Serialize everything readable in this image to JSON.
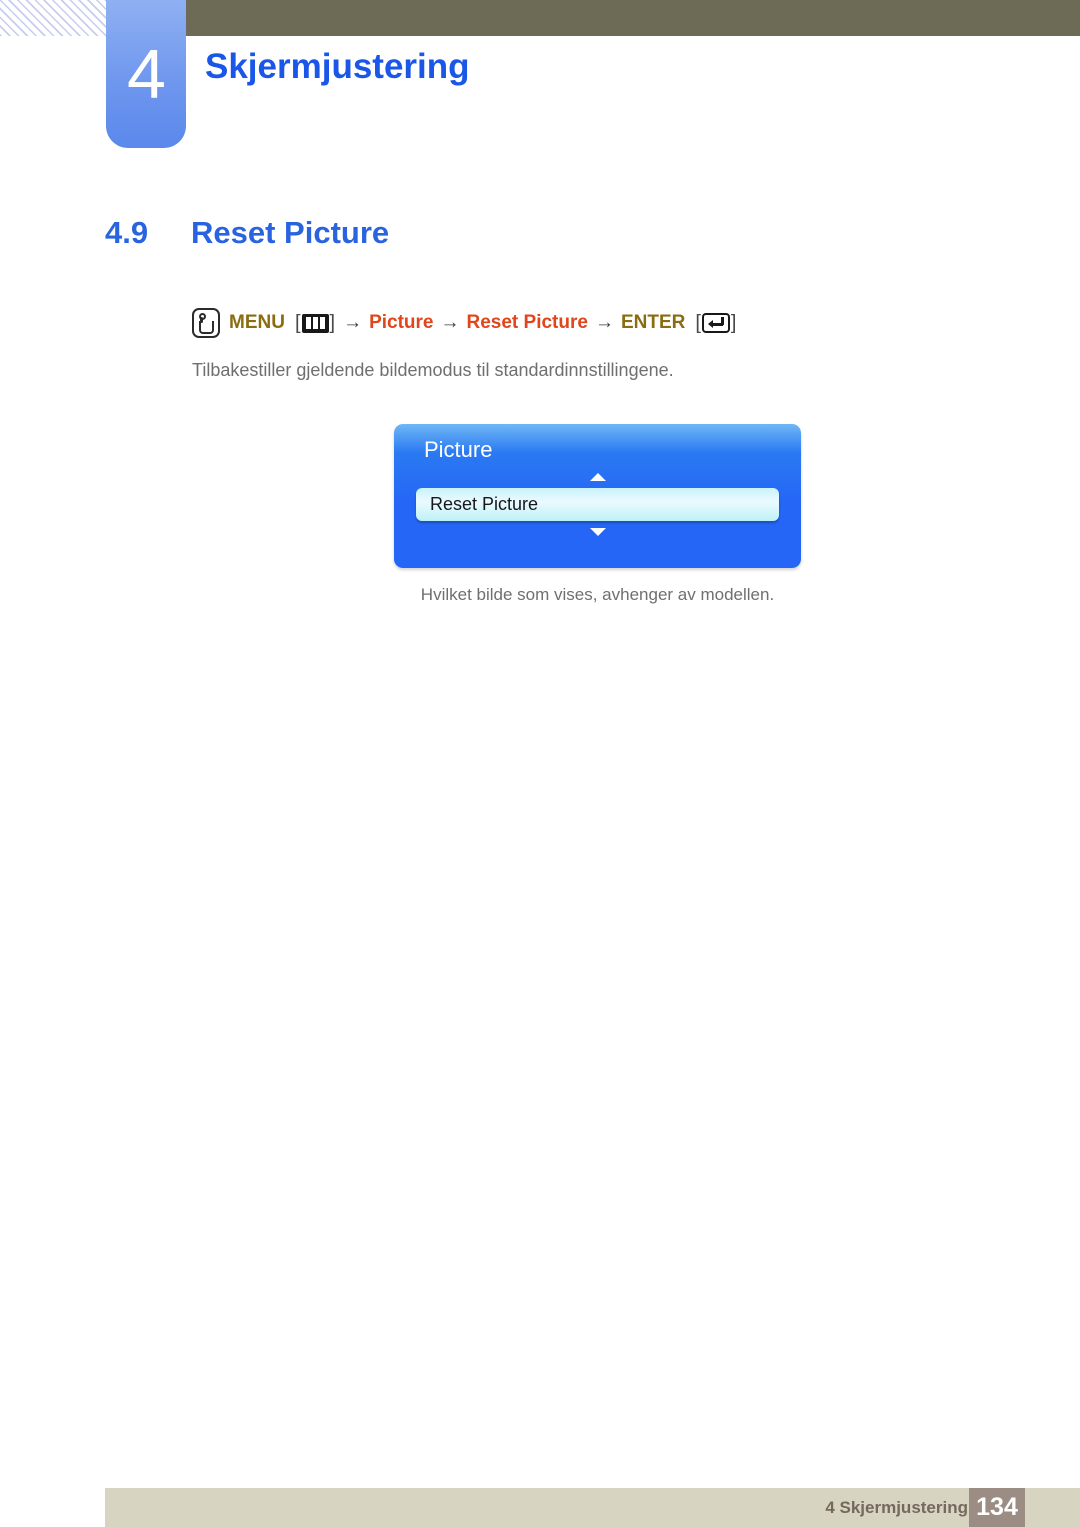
{
  "header": {
    "chapter_number": "4",
    "chapter_title": "Skjermjustering",
    "bar_color": "#6d6b55",
    "accent_color": "#1a57e8"
  },
  "section": {
    "number": "4.9",
    "title": "Reset Picture"
  },
  "menu_path": {
    "touch_icon": "touch-hand-icon",
    "menu_label": "MENU",
    "menu_icon": "menu-bars-icon",
    "arrow": "→",
    "step_picture": "Picture",
    "step_reset_picture": "Reset Picture",
    "enter_label": "ENTER",
    "enter_icon": "enter-return-icon",
    "bracket_open": "[",
    "bracket_close": "]",
    "olive_color": "#8a6d10",
    "red_color": "#e0461b"
  },
  "body": {
    "description": "Tilbakestiller gjeldende bildemodus til standardinnstillingene."
  },
  "osd": {
    "title": "Picture",
    "arrow_up": "scroll-up-arrow",
    "arrow_down": "scroll-down-arrow",
    "selected_item": "Reset Picture",
    "panel_color": "#2566f6",
    "highlight_color": "#c9f2fb"
  },
  "caption": {
    "text": "Hvilket bilde som vises, avhenger av modellen."
  },
  "footer": {
    "text": "4 Skjermjustering",
    "page_number": "134",
    "bar_color": "#d8d4c2",
    "page_box_color": "#9b8d83"
  }
}
